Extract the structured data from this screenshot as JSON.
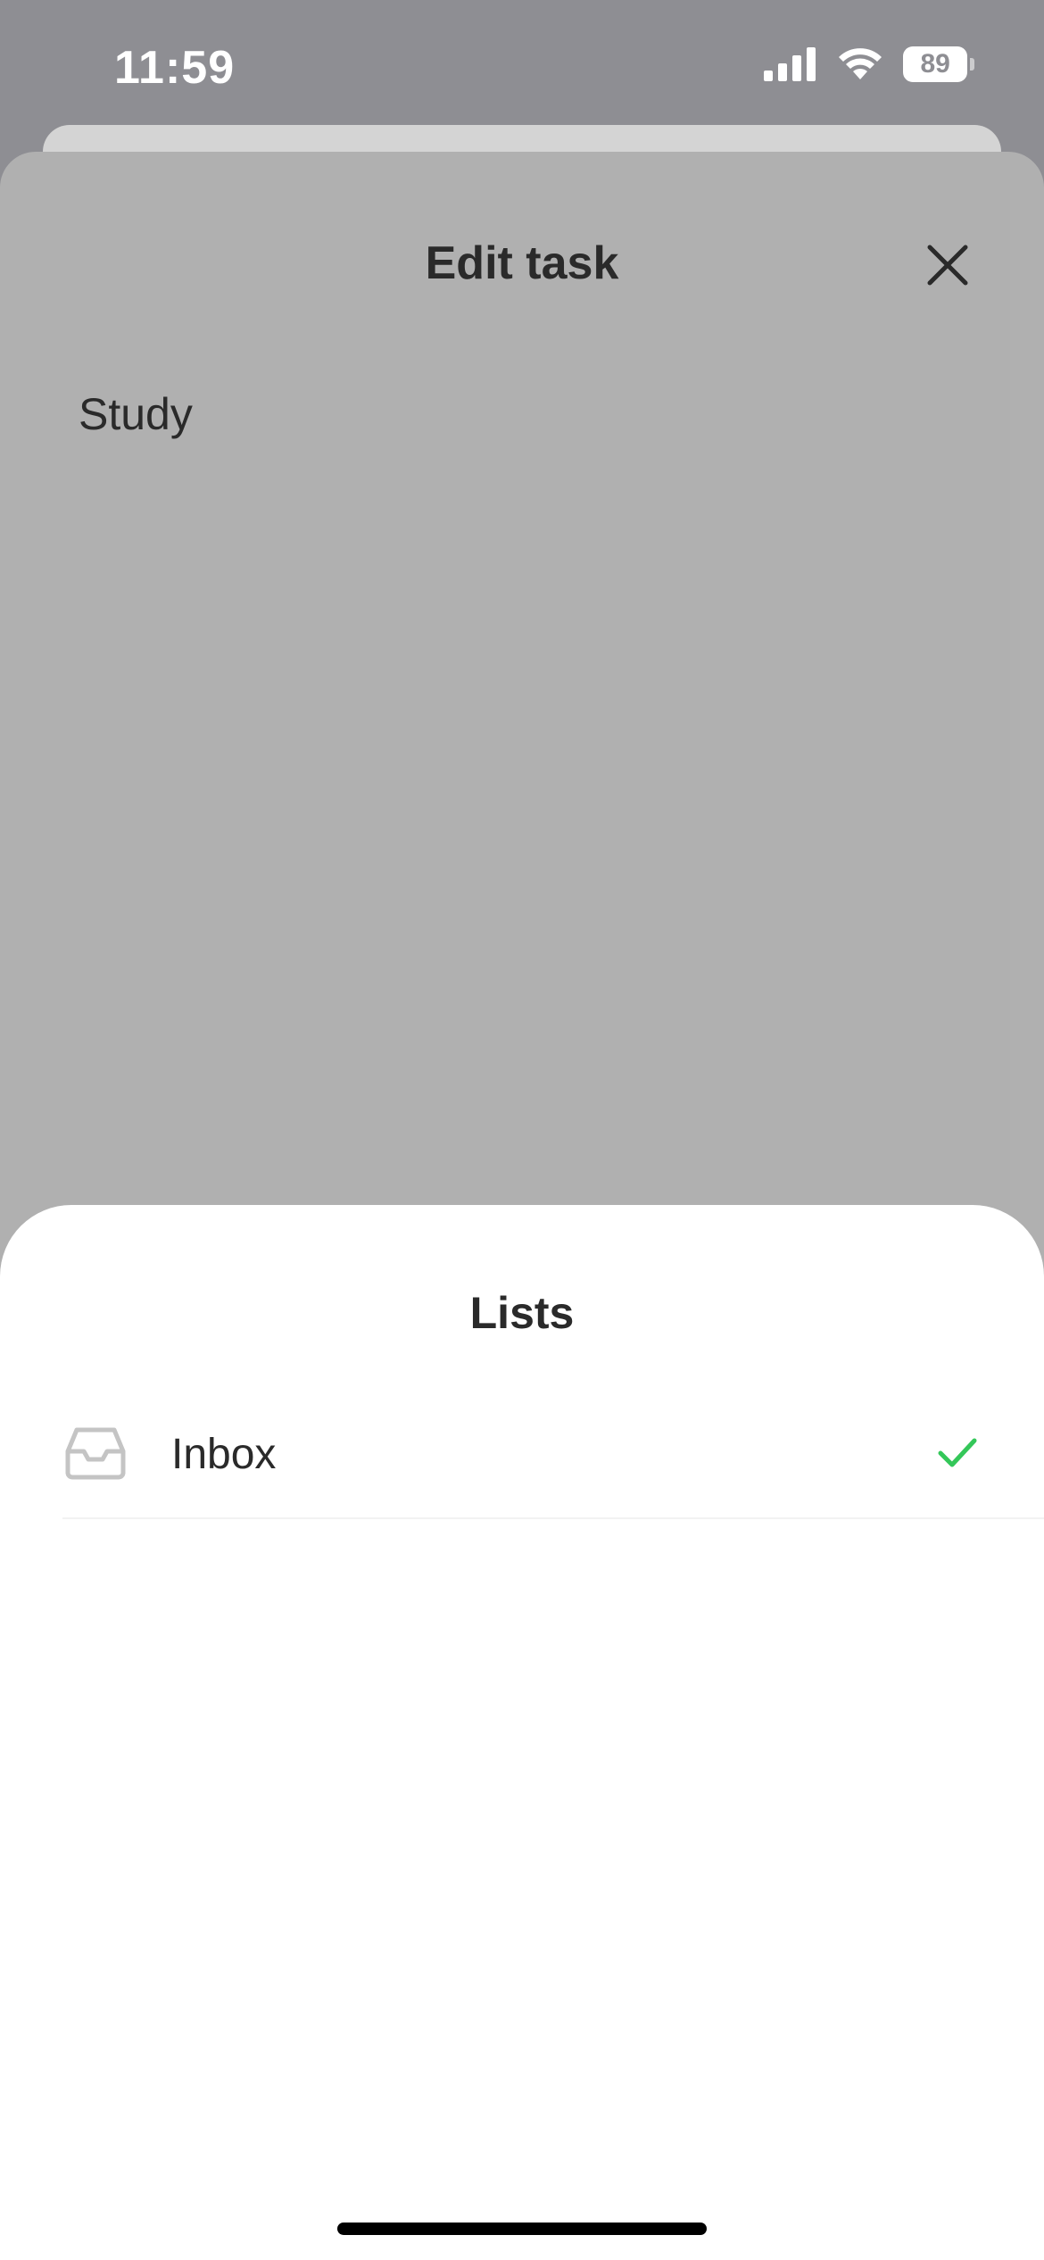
{
  "status_bar": {
    "time": "11:59",
    "battery_level": "89"
  },
  "edit_task": {
    "title": "Edit task",
    "task_name": "Study"
  },
  "lists_sheet": {
    "title": "Lists",
    "items": [
      {
        "label": "Inbox",
        "icon": "inbox-icon",
        "selected": true
      }
    ]
  },
  "colors": {
    "check": "#34c759",
    "dim_overlay": "#b0b0b0",
    "sheet_background": "#ffffff"
  }
}
